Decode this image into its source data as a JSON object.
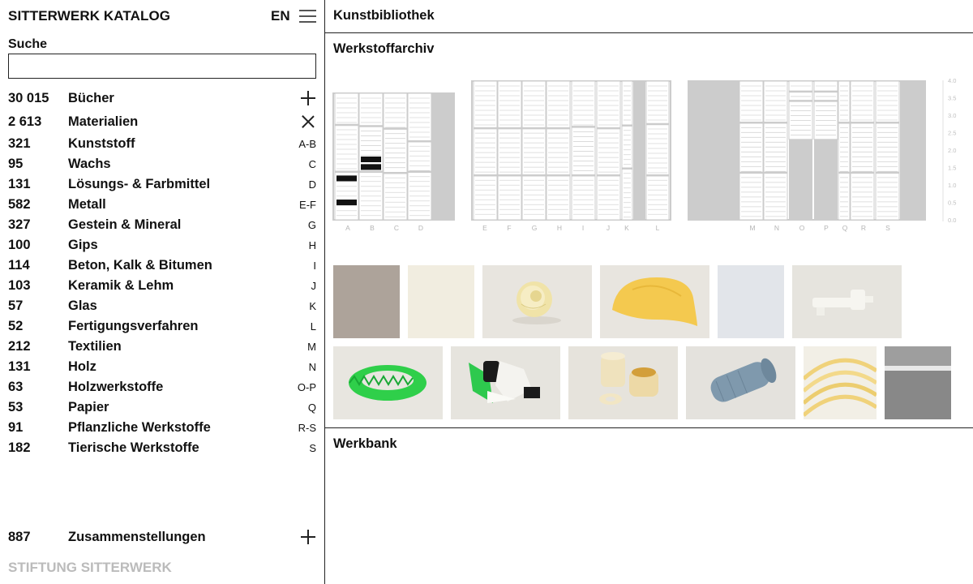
{
  "app": {
    "title": "SITTERWERK KATALOG",
    "language": "EN",
    "foundation": "STIFTUNG SITTERWERK"
  },
  "search": {
    "label": "Suche",
    "value": "",
    "placeholder": ""
  },
  "books": {
    "count": "30 015",
    "label": "Bücher"
  },
  "materials": {
    "count": "2 613",
    "label": "Materialien"
  },
  "categories": [
    {
      "count": "321",
      "label": "Kunststoff",
      "range": "A-B"
    },
    {
      "count": "95",
      "label": "Wachs",
      "range": "C"
    },
    {
      "count": "131",
      "label": "Lösungs- & Farbmittel",
      "range": "D"
    },
    {
      "count": "582",
      "label": "Metall",
      "range": "E-F"
    },
    {
      "count": "327",
      "label": "Gestein & Mineral",
      "range": "G"
    },
    {
      "count": "100",
      "label": "Gips",
      "range": "H"
    },
    {
      "count": "114",
      "label": "Beton, Kalk & Bitumen",
      "range": "I"
    },
    {
      "count": "103",
      "label": "Keramik & Lehm",
      "range": "J"
    },
    {
      "count": "57",
      "label": "Glas",
      "range": "K"
    },
    {
      "count": "52",
      "label": "Fertigungsverfahren",
      "range": "L"
    },
    {
      "count": "212",
      "label": "Textilien",
      "range": "M"
    },
    {
      "count": "131",
      "label": "Holz",
      "range": "N"
    },
    {
      "count": "63",
      "label": "Holzwerkstoffe",
      "range": "O-P"
    },
    {
      "count": "53",
      "label": "Papier",
      "range": "Q"
    },
    {
      "count": "91",
      "label": "Pflanzliche Werkstoffe",
      "range": "R-S"
    },
    {
      "count": "182",
      "label": "Tierische Werkstoffe",
      "range": "S"
    }
  ],
  "compositions": {
    "count": "887",
    "label": "Zusammenstellungen"
  },
  "sections": {
    "library": "Kunstbibliothek",
    "archive": "Werkstoffarchiv",
    "workbench": "Werkbank"
  },
  "archive": {
    "shelf_labels_1": [
      "A",
      "B",
      "C",
      "D"
    ],
    "shelf_labels_2": [
      "E",
      "F",
      "G",
      "H",
      "I",
      "J",
      "K",
      "L"
    ],
    "shelf_labels_3": [
      "M",
      "N",
      "O",
      "P",
      "Q",
      "R",
      "S"
    ],
    "height_scale": [
      "4.0",
      "3.5",
      "3.0",
      "2.5",
      "2.0",
      "1.5",
      "1.0",
      "0.5",
      "0.0"
    ]
  },
  "thumbnails": [
    {
      "name": "taupe-panel-thumb",
      "bg": "#ada39a",
      "object": "none"
    },
    {
      "name": "cream-panel-thumb",
      "bg": "#f1ede0",
      "object": "none"
    },
    {
      "name": "yellow-rose-thumb",
      "bg": "#e8e5df",
      "object": "rose"
    },
    {
      "name": "yellow-blob-thumb",
      "bg": "#e8e5df",
      "object": "blob"
    },
    {
      "name": "pale-blue-panel-thumb",
      "bg": "#e2e5ea",
      "object": "none"
    },
    {
      "name": "white-key-thumb",
      "bg": "#e6e4de",
      "object": "key"
    },
    {
      "name": "green-ring-thumb",
      "bg": "#e8e6e0",
      "object": "greenring"
    },
    {
      "name": "green-black-parts-thumb",
      "bg": "#e6e4de",
      "object": "parts"
    },
    {
      "name": "ivory-cylinder-thumb",
      "bg": "#e6e3dc",
      "object": "cylinder"
    },
    {
      "name": "gray-roll-thumb",
      "bg": "#e4e2dd",
      "object": "roll"
    },
    {
      "name": "amber-tubes-thumb",
      "bg": "#f2efe6",
      "object": "tubes"
    },
    {
      "name": "gray-stripe-thumb",
      "bg": "#8c8c8c",
      "object": "stripe"
    }
  ]
}
